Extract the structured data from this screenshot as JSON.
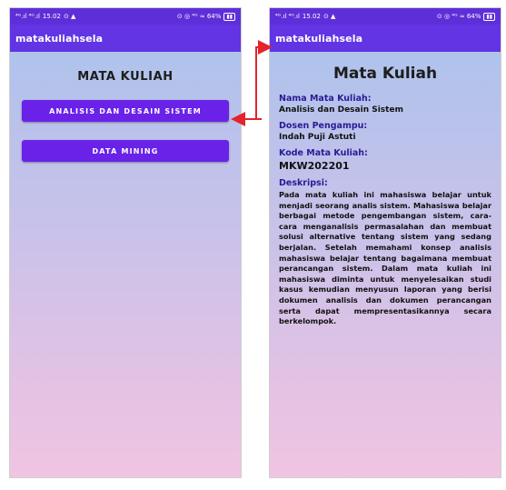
{
  "status_bar": {
    "signal": "⁴ᴳ.ıl ⁴ᴳ.ıl",
    "time": "15.02",
    "icons_right": "⊙ ◎ ⁴ᴳ ≈ 64%"
  },
  "left_screen": {
    "app_title": "matakuliahsela",
    "heading": "MATA KULIAH",
    "buttons": [
      "ANALISIS DAN DESAIN SISTEM",
      "DATA MINING"
    ]
  },
  "right_screen": {
    "app_title": "matakuliahsela",
    "heading": "Mata Kuliah",
    "fields": [
      {
        "label": "Nama Mata Kuliah:",
        "value": "Analisis dan Desain Sistem"
      },
      {
        "label": "Dosen Pengampu:",
        "value": "Indah Puji Astuti"
      },
      {
        "label": "Kode Mata Kuliah:",
        "value": "MKW202201"
      }
    ],
    "description_label": "Deskripsi:",
    "description": "Pada mata kuliah ini mahasiswa belajar untuk menjadi seorang analis sistem. Mahasiswa belajar berbagai metode pengembangan sistem, cara-cara menganalisis permasalahan dan membuat solusi alternative tentang sistem yang sedang berjalan. Setelah memahami konsep analisis mahasiswa belajar tentang bagaimana membuat perancangan sistem. Dalam mata kuliah ini mahasiswa diminta untuk menyelesaikan studi kasus kemudian menyusun laporan yang berisi dokumen analisis dan dokumen perancangan serta dapat mempresentasikannya secara berkelompok."
  },
  "colors": {
    "appbar": "#6234e4",
    "statusbar": "#5e2fd8",
    "button": "#6a22e8",
    "arrow": "#e3242b",
    "label": "#2a1a96"
  }
}
